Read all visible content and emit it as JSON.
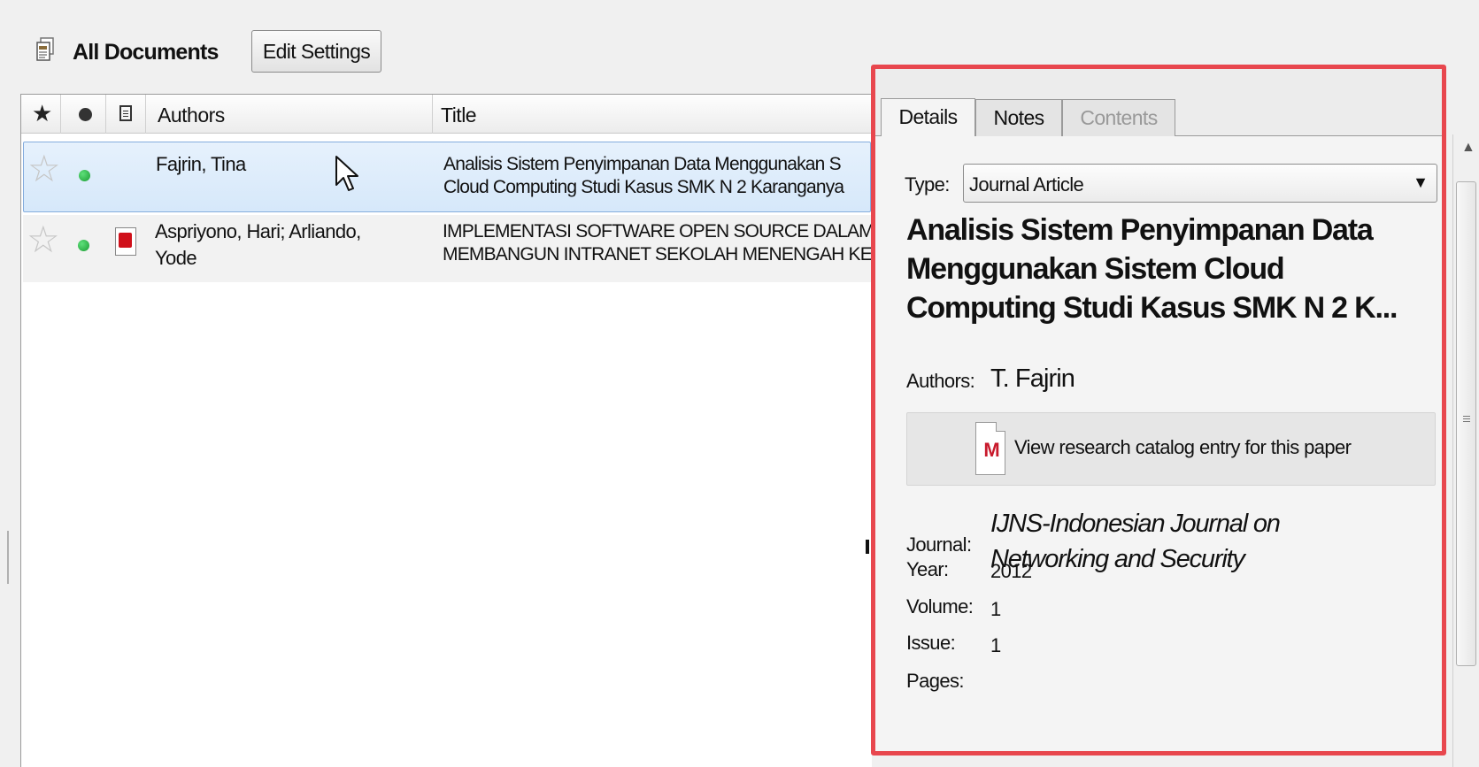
{
  "header": {
    "title": "All Documents",
    "edit_settings_label": "Edit Settings"
  },
  "list": {
    "columns": {
      "authors": "Authors",
      "title": "Title"
    },
    "rows": [
      {
        "authors_line1": "Fajrin, Tina",
        "authors_line2": "",
        "title_line1": "Analisis Sistem Penyimpanan Data Menggunakan S",
        "title_line2": "Cloud Computing Studi Kasus SMK N 2 Karanganya",
        "starred": false,
        "read_status": "unread",
        "has_pdf": false,
        "selected": true
      },
      {
        "authors_line1": "Aspriyono, Hari; Arliando,",
        "authors_line2": "Yode",
        "title_line1": "IMPLEMENTASI SOFTWARE OPEN SOURCE DALAM",
        "title_line2": "MEMBANGUN INTRANET SEKOLAH MENENGAH KE",
        "starred": false,
        "read_status": "unread",
        "has_pdf": true,
        "selected": false
      }
    ]
  },
  "details_panel": {
    "tabs": [
      {
        "label": "Details",
        "active": true,
        "enabled": true
      },
      {
        "label": "Notes",
        "active": false,
        "enabled": true
      },
      {
        "label": "Contents",
        "active": false,
        "enabled": false
      }
    ],
    "type_label": "Type:",
    "type_value": "Journal Article",
    "title_line1": "Analisis Sistem Penyimpanan Data",
    "title_line2": "Menggunakan Sistem Cloud",
    "title_line3": "Computing Studi Kasus SMK N 2 K...",
    "authors_label": "Authors:",
    "authors_value": "T. Fajrin",
    "catalog_link": "View research catalog entry for this paper",
    "journal_label": "Journal:",
    "journal_line1": "IJNS-Indonesian Journal on",
    "journal_line2": "Networking and Security",
    "year_label": "Year:",
    "year_value": "2012",
    "volume_label": "Volume:",
    "volume_value": "1",
    "issue_label": "Issue:",
    "issue_value": "1",
    "pages_label": "Pages:",
    "pages_value": ""
  },
  "colors": {
    "highlight_border": "#e8474e",
    "selection_bg": "#d6e8fa",
    "read_dot": "#1b9b33",
    "pdf_red": "#d0101a"
  },
  "icons": {
    "documents": "documents-icon",
    "star": "star-icon",
    "dot": "read-status-icon",
    "file": "file-icon",
    "pdf": "pdf-icon",
    "catalog": "research-catalog-icon",
    "dropdown": "chevron-down-icon"
  }
}
